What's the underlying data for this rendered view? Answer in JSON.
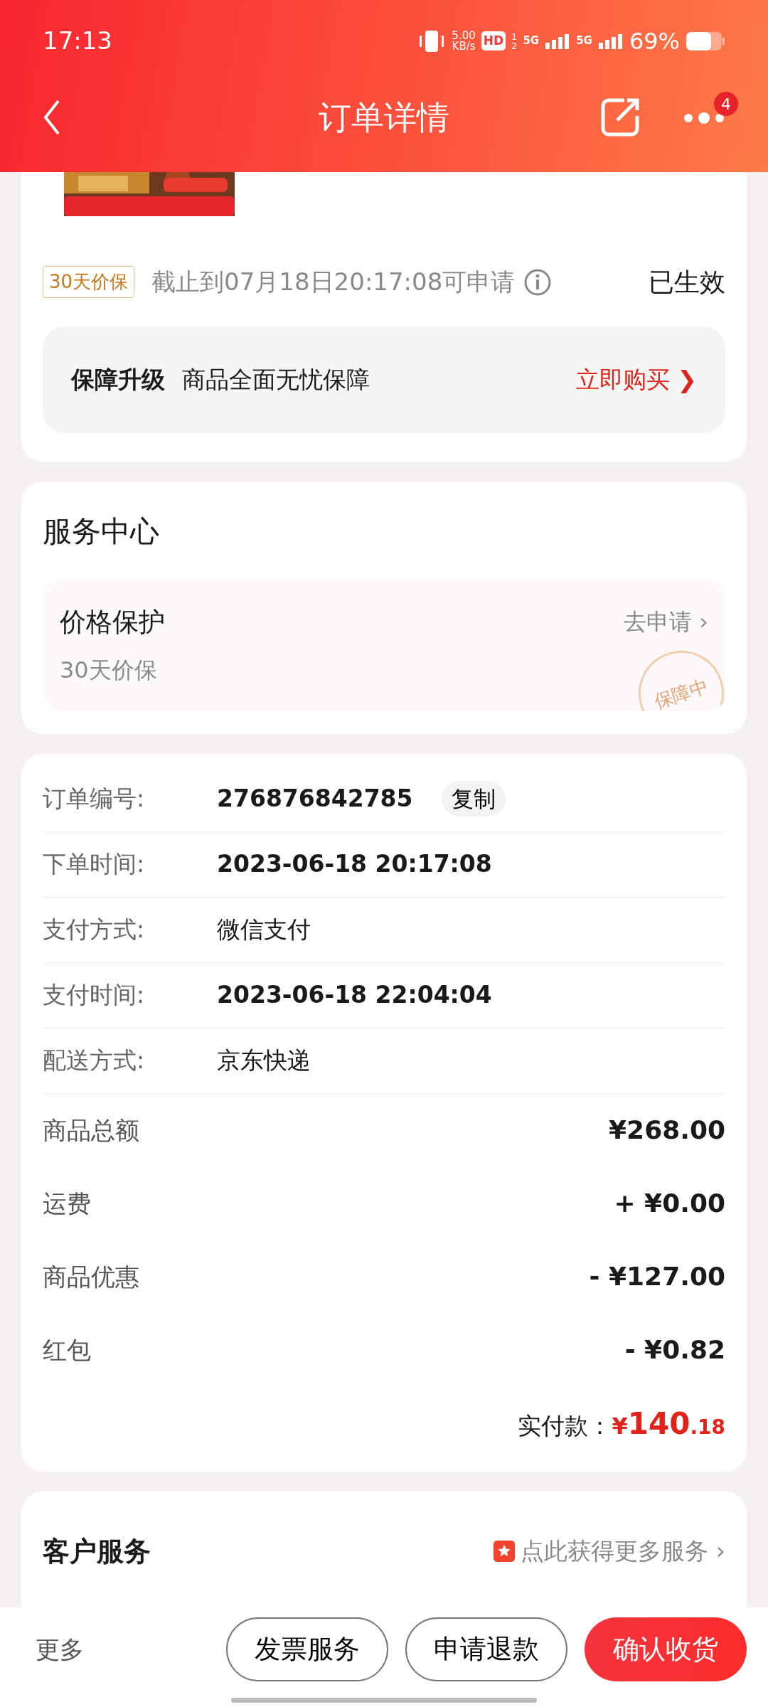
{
  "status_bar": {
    "time": "17:13",
    "net_speed": "5.00",
    "net_unit": "KB/s",
    "hd_label": "HD",
    "sim_slots": [
      "1",
      "2"
    ],
    "networks": [
      "5G",
      "5G"
    ],
    "battery": "69%"
  },
  "header": {
    "title": "订单详情",
    "badge": "4"
  },
  "price_protect": {
    "tag": "30天价保",
    "deadline": "截止到07月18日20:17:08可申请",
    "status": "已生效"
  },
  "upgrade": {
    "label": "保障升级",
    "description": "商品全面无忧保障",
    "action": "立即购买",
    "chevron": "❯"
  },
  "service_center": {
    "title": "服务中心",
    "item": {
      "title": "价格保护",
      "subtitle": "30天价保",
      "action": "去申请",
      "chevron": "›",
      "stamp": "保障中"
    }
  },
  "order_info": [
    {
      "label": "订单编号:",
      "value": "276876842785",
      "bold": true,
      "button": "复制"
    },
    {
      "label": "下单时间:",
      "value": "2023-06-18 20:17:08",
      "bold": true
    },
    {
      "label": "支付方式:",
      "value": "微信支付",
      "bold": false
    },
    {
      "label": "支付时间:",
      "value": "2023-06-18 22:04:04",
      "bold": true
    },
    {
      "label": "配送方式:",
      "value": "京东快递",
      "bold": false
    }
  ],
  "amounts": [
    {
      "label": "商品总额",
      "value": "¥268.00"
    },
    {
      "label": "运费",
      "value": "+ ¥0.00"
    },
    {
      "label": "商品优惠",
      "value": "- ¥127.00"
    },
    {
      "label": "红包",
      "value": "- ¥0.82"
    }
  ],
  "total": {
    "label": "实付款：",
    "currency": "¥",
    "integer": "140",
    "decimal": ".18"
  },
  "customer_service": {
    "title": "客户服务",
    "link": "点此获得更多服务",
    "chevron": "›"
  },
  "bottom_bar": {
    "more": "更多",
    "buttons": [
      {
        "label": "发票服务",
        "kind": "outline"
      },
      {
        "label": "申请退款",
        "kind": "outline"
      },
      {
        "label": "确认收货",
        "kind": "primary"
      }
    ]
  }
}
